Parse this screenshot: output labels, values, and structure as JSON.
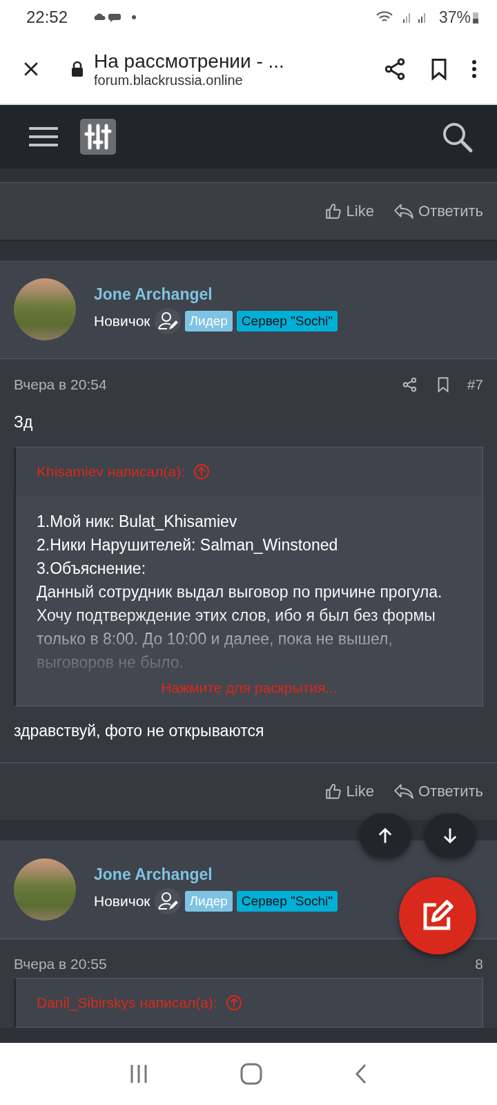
{
  "status_bar": {
    "time": "22:52",
    "battery": "37%"
  },
  "browser": {
    "title": "На рассмотрении - ...",
    "url": "forum.blackrussia.online"
  },
  "previous_post_actions": {
    "like": "Like",
    "reply": "Ответить"
  },
  "posts": [
    {
      "author": "Jone Archangel",
      "rank": "Новичок",
      "badges": [
        {
          "text": "Лидер",
          "color": "#7ec3e3"
        },
        {
          "text": "Сервер \"Sochi\"",
          "color": "#00afd6"
        }
      ],
      "date": "Вчера в 20:54",
      "number": "#7",
      "show_tools": true,
      "text": "Зд",
      "quote": {
        "author": "Khisamiev написал(а):",
        "lines": [
          "1.Мой ник: Bulat_Khisamiev",
          "2.Ники Нарушителей: Salman_Winstoned",
          "3.Объяснение:",
          "Данный сотрудник выдал выговор по причине прогула. Хочу подтверждение этих слов, ибо я был без формы только в 8:00. До 10:00 и далее, пока не вышел, выговоров не было."
        ],
        "expand": "Нажмите для раскрытия..."
      },
      "reply_text": "здравствуй, фото не открываются",
      "actions": {
        "like": "Like",
        "reply": "Ответить"
      }
    },
    {
      "author": "Jone Archangel",
      "rank": "Новичок",
      "badges": [
        {
          "text": "Лидер",
          "color": "#7ec3e3"
        },
        {
          "text": "Сервер \"Sochi\"",
          "color": "#00afd6"
        }
      ],
      "date": "Вчера в 20:55",
      "number": "8",
      "show_tools": false,
      "quote": {
        "author": "Danil_Sibirskys написал(а):"
      }
    }
  ]
}
